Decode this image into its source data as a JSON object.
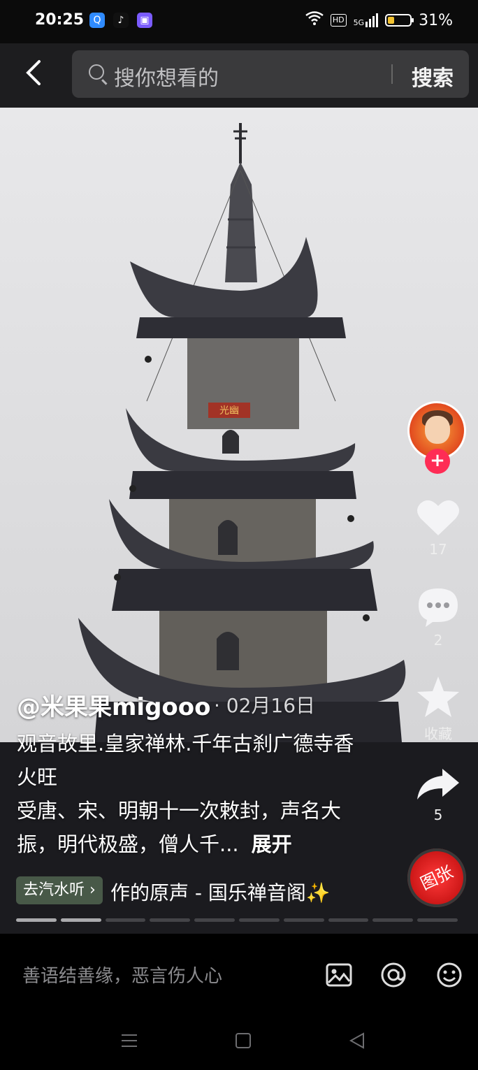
{
  "status_bar": {
    "time": "20:25",
    "battery_percent": "31%",
    "battery_level": 0.31,
    "network_badges": [
      "HD",
      "5G"
    ]
  },
  "search": {
    "placeholder": "搜你想看的",
    "button_label": "搜索"
  },
  "video": {
    "author": "@米果果migooo",
    "date": "· 02月16日",
    "description_line1": "观音故里.皇家禅林.千年古刹广德寺香火旺",
    "description_line2": "受唐、宋、明朝十一次敕封，声名大振，明代极盛，僧人千...",
    "expand_label": "展开",
    "plaque_text": "光幽",
    "music_chip": "去汽水听",
    "music_title": "作的原声 - 国乐禅音阁✨",
    "progress_segments": 10,
    "progress_done": 2
  },
  "actions": {
    "likes": "17",
    "comments": "2",
    "favorite_label": "收藏",
    "shares": "5",
    "disc_text": "图张"
  },
  "comment_bar": {
    "placeholder": "善语结善缘，恶言伤人心"
  },
  "colors": {
    "accent": "#fe2c55",
    "disc": "#d61a1a",
    "battery": "#f2c230"
  }
}
